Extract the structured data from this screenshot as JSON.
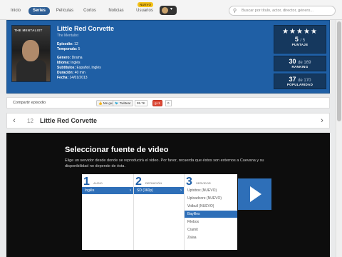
{
  "nav": {
    "items": [
      "Inicio",
      "Series",
      "Películas",
      "Cortos",
      "Noticias",
      "Usuarios"
    ],
    "badge": "NUEVO",
    "search_placeholder": "Buscar por título, actor, director, género..."
  },
  "episode": {
    "title": "Little Red Corvette",
    "show": "The Mentalist",
    "poster_text": "THE MENTALIST",
    "meta": [
      {
        "label": "Episodio:",
        "value": "12"
      },
      {
        "label": "Temporada:",
        "value": "5"
      },
      {
        "label": "Género:",
        "value": "Drama"
      },
      {
        "label": "Idioma:",
        "value": "Inglés"
      },
      {
        "label": "Subtítulos:",
        "value": "Español, Inglés"
      },
      {
        "label": "Duración:",
        "value": "40 min"
      },
      {
        "label": "Fecha:",
        "value": "14/01/2013"
      }
    ],
    "rating_stars": "★★★★★",
    "rating": "5",
    "rating_of": "/ 5",
    "rating_label": "PUNTAJE",
    "ranking": "30",
    "ranking_of": "de 169",
    "ranking_label": "RANKING",
    "popularity": "37",
    "popularity_of": "de 170",
    "popularity_label": "POPULARIDAD"
  },
  "share": {
    "label": "Compartir episodio",
    "like": "Me gusta",
    "like_count": "0",
    "tweet": "Twittear",
    "tweet_count": "95.7K",
    "gplus": "+1",
    "gplus_count": "0"
  },
  "episode_nav": {
    "number": "12",
    "title": "Little Red Corvette"
  },
  "player": {
    "title": "Seleccionar fuente de video",
    "description": "Elige un servidor desde donde se reproducirá el video. Por favor, recuerda que éstos son externos a Cuevana y su disponibilidad no depende de ésta.",
    "columns": [
      {
        "num": "1",
        "label": "AUDIO",
        "options": [
          "Inglés"
        ]
      },
      {
        "num": "2",
        "label": "DEFINICIÓN",
        "options": [
          "SD (360p)"
        ]
      },
      {
        "num": "3",
        "label": "SERVIDOR",
        "options": [
          "Uptobox (NUEVO)",
          "Uploadcore (NUEVO)",
          "Vidbull (NUEVO)",
          "Bayfiles",
          "Filebox",
          "Cramit",
          "Zalaa"
        ]
      }
    ]
  }
}
